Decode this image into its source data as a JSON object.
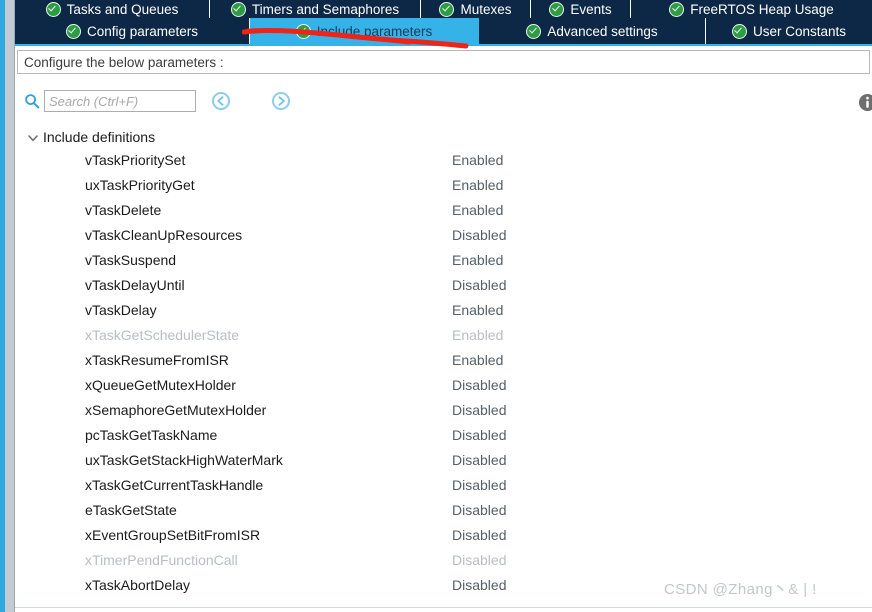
{
  "window": {
    "accent_color": "#2fa8e0",
    "tabbar_color": "#0d2746",
    "selected_tab_color": "#35b3e8",
    "annotation_color": "#ee2418"
  },
  "tabs_top": [
    {
      "label": "Tasks and Queues",
      "icon": "green-check-icon",
      "selected": false
    },
    {
      "label": "Timers and Semaphores",
      "icon": "green-check-icon",
      "selected": false
    },
    {
      "label": "Mutexes",
      "icon": "green-check-icon",
      "selected": false
    },
    {
      "label": "Events",
      "icon": "green-check-icon",
      "selected": false
    },
    {
      "label": "FreeRTOS Heap Usage",
      "icon": "green-check-icon",
      "selected": false
    }
  ],
  "tabs_bottom": [
    {
      "label": "Config parameters",
      "icon": "green-check-icon",
      "selected": false
    },
    {
      "label": "Include parameters",
      "icon": "green-check-icon",
      "selected": true
    },
    {
      "label": "Advanced settings",
      "icon": "green-check-icon",
      "selected": false
    },
    {
      "label": "User Constants",
      "icon": "green-check-icon",
      "selected": false
    }
  ],
  "header": {
    "title": "Configure the below parameters :"
  },
  "toolbar": {
    "search_icon": "search-icon",
    "search_placeholder": "Search (Ctrl+F)",
    "search_value": "",
    "prev_label": "previous-match",
    "next_label": "next-match",
    "info_icon": "info-icon"
  },
  "tree": {
    "root_label": "Include definitions",
    "expanded": true,
    "chevron_icon": "chevron-down-icon",
    "rows": [
      {
        "name": "vTaskPrioritySet",
        "value": "Enabled",
        "dimmed": false
      },
      {
        "name": "uxTaskPriorityGet",
        "value": "Enabled",
        "dimmed": false
      },
      {
        "name": "vTaskDelete",
        "value": "Enabled",
        "dimmed": false
      },
      {
        "name": "vTaskCleanUpResources",
        "value": "Disabled",
        "dimmed": false
      },
      {
        "name": "vTaskSuspend",
        "value": "Enabled",
        "dimmed": false
      },
      {
        "name": "vTaskDelayUntil",
        "value": "Disabled",
        "dimmed": false
      },
      {
        "name": "vTaskDelay",
        "value": "Enabled",
        "dimmed": false
      },
      {
        "name": "xTaskGetSchedulerState",
        "value": "Enabled",
        "dimmed": true
      },
      {
        "name": "xTaskResumeFromISR",
        "value": "Enabled",
        "dimmed": false
      },
      {
        "name": "xQueueGetMutexHolder",
        "value": "Disabled",
        "dimmed": false
      },
      {
        "name": "xSemaphoreGetMutexHolder",
        "value": "Disabled",
        "dimmed": false
      },
      {
        "name": "pcTaskGetTaskName",
        "value": "Disabled",
        "dimmed": false
      },
      {
        "name": "uxTaskGetStackHighWaterMark",
        "value": "Disabled",
        "dimmed": false
      },
      {
        "name": "xTaskGetCurrentTaskHandle",
        "value": "Disabled",
        "dimmed": false
      },
      {
        "name": "eTaskGetState",
        "value": "Disabled",
        "dimmed": false
      },
      {
        "name": "xEventGroupSetBitFromISR",
        "value": "Disabled",
        "dimmed": false
      },
      {
        "name": "xTimerPendFunctionCall",
        "value": "Disabled",
        "dimmed": true
      },
      {
        "name": "xTaskAbortDelay",
        "value": "Disabled",
        "dimmed": false
      }
    ]
  },
  "watermark": {
    "text": "CSDN @Zhang丶& | !"
  }
}
